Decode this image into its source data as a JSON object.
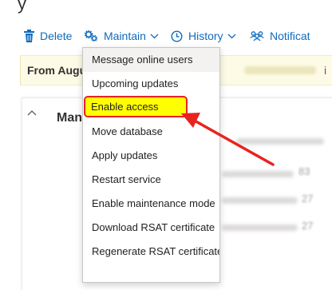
{
  "page": {
    "title_fragment": "y"
  },
  "toolbar": {
    "delete_label": "Delete",
    "maintain_label": "Maintain",
    "history_label": "History",
    "notifications_label": "Notificat"
  },
  "banner": {
    "text": "From Augu",
    "trailing": "i"
  },
  "card": {
    "title": "Man"
  },
  "maintain_menu": {
    "items": [
      "Message online users",
      "Upcoming updates",
      "Enable access",
      "Move database",
      "Apply updates",
      "Restart service",
      "Enable maintenance mode",
      "Download RSAT certificate",
      "Regenerate RSAT certificate"
    ],
    "highlighted_item": "Enable access"
  },
  "background_values": [
    "83",
    "27",
    "27"
  ],
  "colors": {
    "accent": "#0f6cbd",
    "highlight_fill": "#ffff00",
    "annotation_red": "#e8231f",
    "banner_bg": "#fdfbe6"
  },
  "icons": {
    "delete": "trash-icon",
    "maintain": "gears-icon",
    "history": "clock-icon",
    "notifications": "people-icon",
    "dropdown": "chevron-down-icon",
    "collapse": "chevron-up-icon"
  }
}
